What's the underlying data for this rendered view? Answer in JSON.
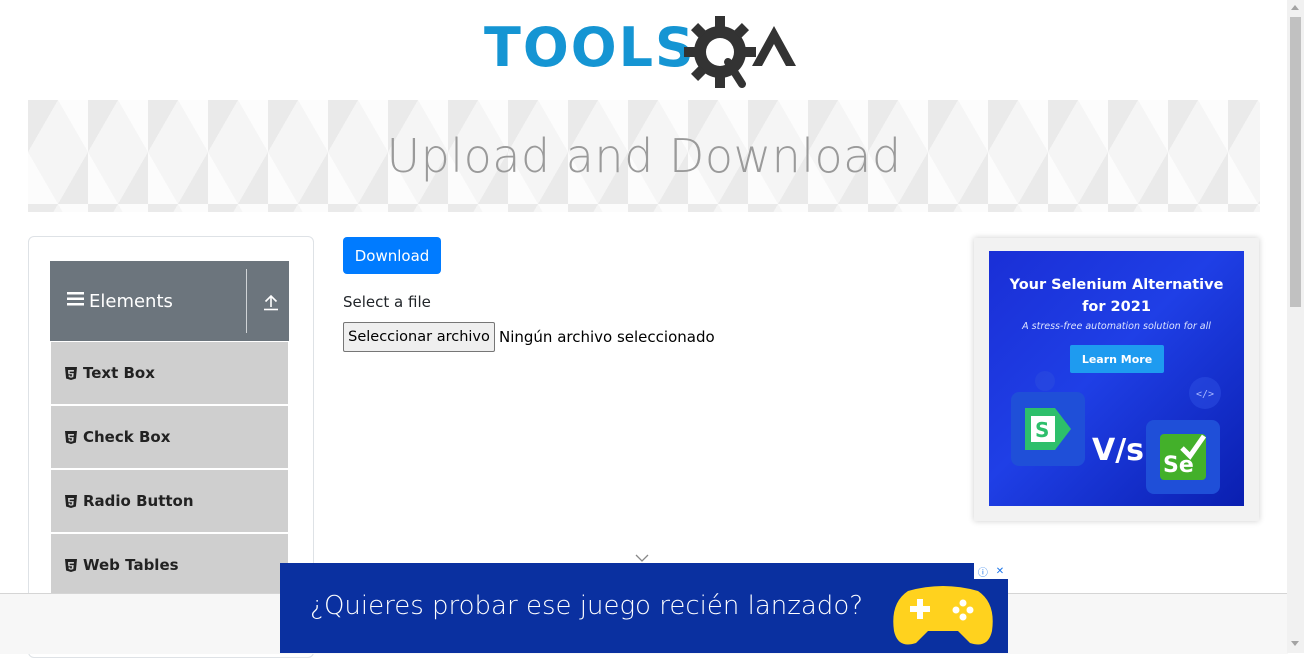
{
  "logo": {
    "part1": "TOOLS",
    "part2": "QA"
  },
  "banner": {
    "title": "Upload and Download"
  },
  "sidebar": {
    "group": {
      "label": "Elements"
    },
    "items": [
      {
        "label": "Text Box"
      },
      {
        "label": "Check Box"
      },
      {
        "label": "Radio Button"
      },
      {
        "label": "Web Tables"
      }
    ]
  },
  "main": {
    "download_label": "Download",
    "file_label": "Select a file",
    "file_button_label": "Seleccionar archivo",
    "file_status": "Ningún archivo seleccionado"
  },
  "ad_right": {
    "headline_line1": "Your Selenium Alternative",
    "headline_line2": "for 2021",
    "subtext": "A stress-free automation solution for all",
    "button_label": "Learn More",
    "vs_text": "V/s"
  },
  "ad_bottom": {
    "text": "¿Quieres probar ese juego recién lanzado?"
  },
  "colors": {
    "logo_blue": "#1595d3",
    "logo_dark": "#333333",
    "primary_button": "#007bff",
    "sidebar_header": "#6c757d",
    "sidebar_item": "#cfcfcf"
  }
}
